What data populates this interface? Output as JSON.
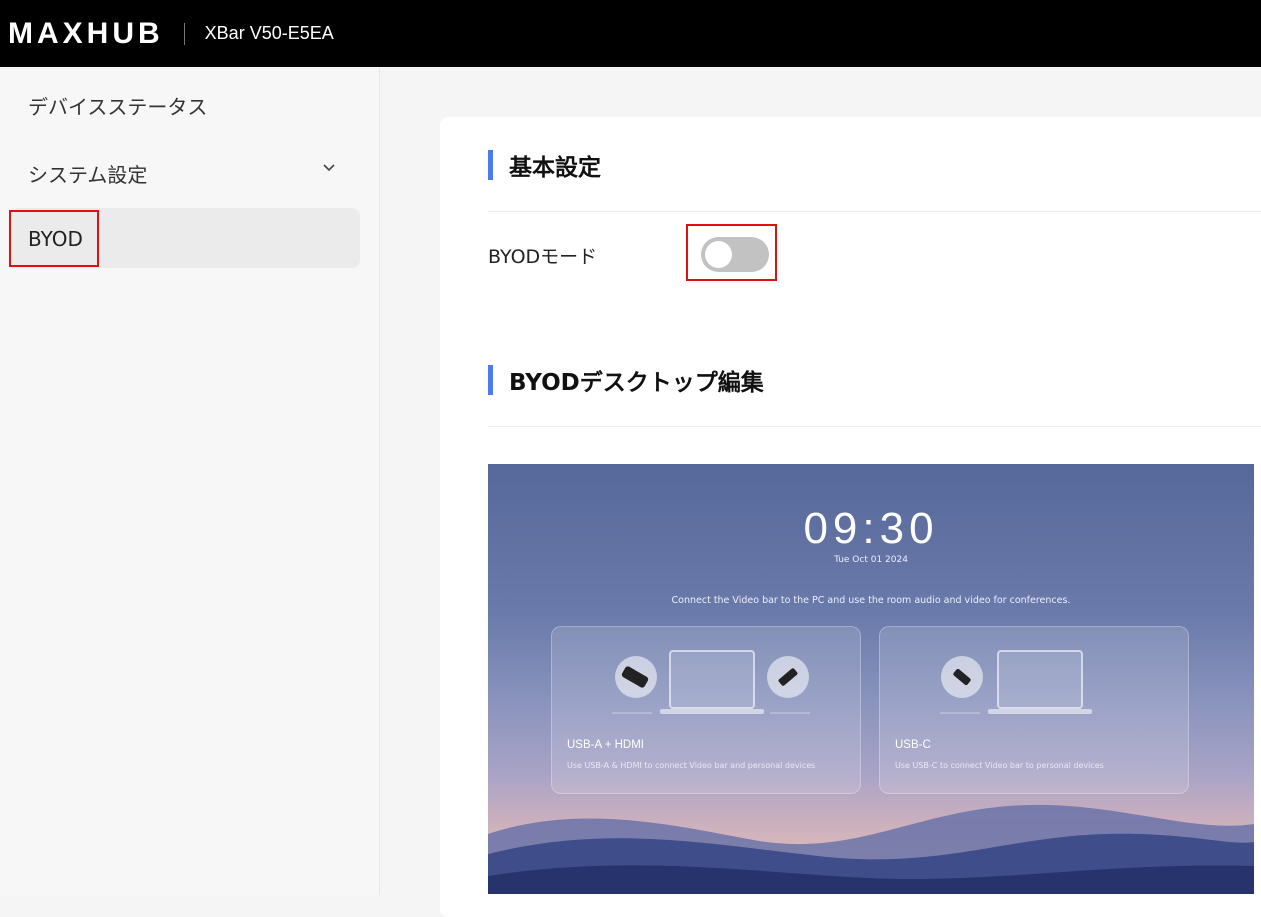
{
  "header": {
    "brand": "MAXHUB",
    "device_name": "XBar V50-E5EA"
  },
  "sidebar": {
    "items": [
      {
        "label": "デバイスステータス"
      },
      {
        "label": "システム設定"
      },
      {
        "label": "BYOD"
      }
    ]
  },
  "main": {
    "basic_settings_title": "基本設定",
    "byod_mode_label": "BYODモード",
    "byod_mode_enabled": false,
    "desktop_edit_title": "BYODデスクトップ編集",
    "preview": {
      "time": "09:30",
      "date": "Tue  Oct 01 2024",
      "connect_text": "Connect the Video bar to the PC and use the room audio and video for conferences.",
      "cards": [
        {
          "title": "USB-A + HDMI",
          "desc": "Use USB-A & HDMI to connect Video bar and personal devices"
        },
        {
          "title": "USB-C",
          "desc": "Use USB-C to connect Video bar to personal devices"
        }
      ]
    }
  },
  "colors": {
    "accent": "#4b7bec",
    "highlight": "#e01010",
    "topbar": "#000000"
  }
}
